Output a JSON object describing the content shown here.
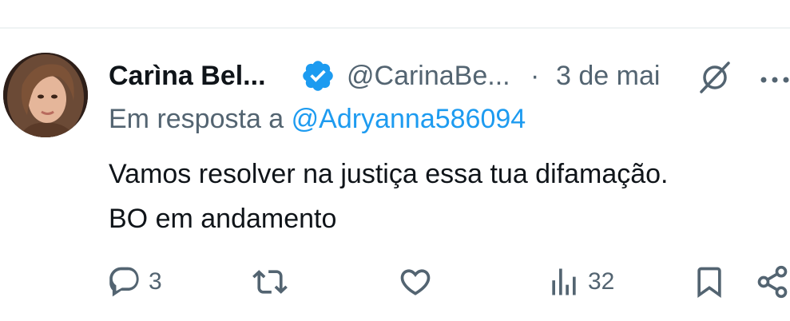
{
  "tweet": {
    "author_name": "Carìna Bel...",
    "handle": "@CarinaBe...",
    "separator": "·",
    "date": "3 de mai",
    "reply_prefix": "Em resposta a",
    "reply_mention": "@Adryanna586094",
    "text_line1": "Vamos resolver na justiça essa tua difamação.",
    "text_line2": "BO em andamento"
  },
  "actions": {
    "reply_count": "3",
    "retweet_count": "",
    "like_count": "",
    "views_count": "32"
  },
  "icons": {
    "verified": "verified-badge-icon",
    "grok": "grok-icon",
    "more": "more-icon",
    "reply": "reply-icon",
    "retweet": "retweet-icon",
    "like": "heart-icon",
    "views": "views-icon",
    "bookmark": "bookmark-icon",
    "share": "share-icon"
  },
  "colors": {
    "text": "#0f1419",
    "secondary": "#536471",
    "accent": "#1d9bf0"
  }
}
